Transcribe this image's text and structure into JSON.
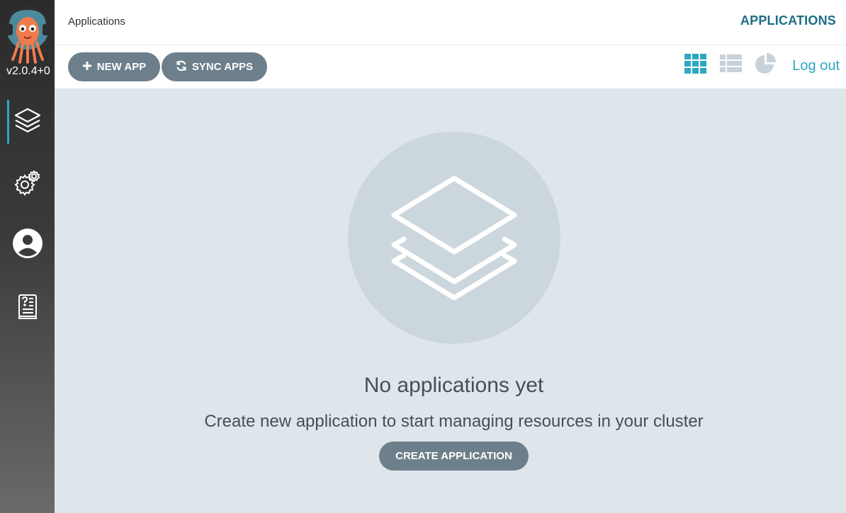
{
  "sidebar": {
    "version": "v2.0.4+0",
    "items": [
      {
        "name": "applications",
        "icon": "layers-icon",
        "active": true
      },
      {
        "name": "settings",
        "icon": "gears-icon",
        "active": false
      },
      {
        "name": "user-info",
        "icon": "user-circle-icon",
        "active": false
      },
      {
        "name": "documentation",
        "icon": "book-icon",
        "active": false
      }
    ]
  },
  "header": {
    "breadcrumb": "Applications",
    "title": "APPLICATIONS"
  },
  "toolbar": {
    "new_app_label": "NEW APP",
    "sync_apps_label": "SYNC APPS",
    "views": [
      "tiles-view",
      "list-view",
      "summary-view"
    ],
    "active_view": "tiles-view",
    "logout_label": "Log out"
  },
  "empty_state": {
    "title": "No applications yet",
    "subtitle": "Create new application to start managing resources in your cluster",
    "create_label": "CREATE APPLICATION"
  },
  "colors": {
    "accent": "#2ea7c0",
    "title": "#1d6f86",
    "button": "#6d7f8b",
    "background": "#dee6eb"
  }
}
